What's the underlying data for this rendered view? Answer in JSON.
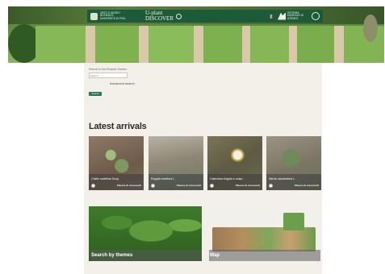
{
  "header": {
    "logo_text": "Orto e Museo Botanico Università di Pisa",
    "app_title_line1": "U-plant",
    "app_title_line2": "DISCOVER",
    "partner_text": "Sistema Museale di Ateneo"
  },
  "search": {
    "label": "Search in the Botanic Garden",
    "placeholder": "Search",
    "advanced_label": "Advanced search",
    "button_label": "Search"
  },
  "arrivals": {
    "title": "Latest arrivals",
    "items": [
      {
        "name": "Cakile maritima Scop.",
        "badge": "Piacere di conoscerti"
      },
      {
        "name": "Ruppia maritima L.",
        "badge": "Piacere di conoscerti"
      },
      {
        "name": "Calendula fulgida e cespi...",
        "badge": "Piacere di conoscerti"
      },
      {
        "name": "Salvia clandestina L.",
        "badge": "Piacere di conoscerti"
      }
    ]
  },
  "tiles": {
    "themes_label": "Search by themes",
    "map_label": "Map"
  },
  "colors": {
    "brand_green": "#1d5a3a",
    "button_green": "#1c7a4f",
    "panel_beige": "#f3f0ea"
  }
}
